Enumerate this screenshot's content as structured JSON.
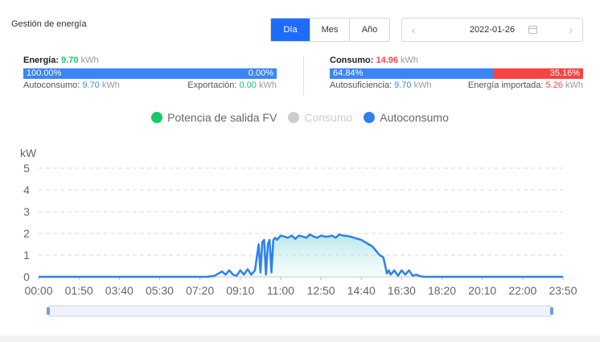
{
  "header": {
    "title": "Gestión de energía"
  },
  "period_tabs": [
    {
      "label": "Día",
      "active": true
    },
    {
      "label": "Mes",
      "active": false
    },
    {
      "label": "Año",
      "active": false
    }
  ],
  "date_picker": {
    "value": "2022-01-26",
    "prev_icon": "chevron-left-icon",
    "next_icon": "chevron-right-icon",
    "calendar_icon": "calendar-icon"
  },
  "energy": {
    "label": "Energía:",
    "value": "9.70",
    "unit": "kWh",
    "bar_left_pct": "100.00%",
    "bar_right_pct": "0.00%",
    "self_consumption_label": "Autoconsumo:",
    "self_consumption_value": "9.70",
    "export_label": "Exportación:",
    "export_value": "0.00"
  },
  "consumption": {
    "label": "Consumo:",
    "value": "14.96",
    "unit": "kWh",
    "bar_left_pct": "64.84%",
    "bar_right_pct": "35.16%",
    "self_sufficiency_label": "Autosuficiencia:",
    "self_sufficiency_value": "9.70",
    "imported_label": "Energía importada:",
    "imported_value": "5.26"
  },
  "legend": [
    {
      "label": "Potencia de salida FV",
      "color": "#17c96b",
      "active": true
    },
    {
      "label": "Consumo",
      "color": "#cccccc",
      "active": false
    },
    {
      "label": "Autoconsumo",
      "color": "#2f80ed",
      "active": true
    }
  ],
  "chart_data": {
    "type": "area",
    "ylabel": "kW",
    "ylim": [
      0,
      5
    ],
    "yticks": [
      "0",
      "1",
      "2",
      "3",
      "4",
      "5"
    ],
    "xticks": [
      "00:00",
      "01:50",
      "03:40",
      "05:30",
      "07:20",
      "09:10",
      "11:00",
      "12:50",
      "14:40",
      "16:30",
      "18:20",
      "20:10",
      "22:00",
      "23:50"
    ],
    "xrange_minutes": [
      0,
      1430
    ],
    "grid": true,
    "series": [
      {
        "name": "Autoconsumo",
        "color": "#2f80ed",
        "x": [
          "00:00",
          "07:40",
          "08:00",
          "08:20",
          "08:30",
          "08:40",
          "08:50",
          "09:00",
          "09:10",
          "09:20",
          "09:30",
          "09:40",
          "09:50",
          "10:00",
          "10:05",
          "10:10",
          "10:15",
          "10:20",
          "10:25",
          "10:30",
          "10:35",
          "10:40",
          "10:45",
          "10:50",
          "11:00",
          "11:10",
          "11:20",
          "11:30",
          "11:40",
          "11:50",
          "12:00",
          "12:10",
          "12:20",
          "12:30",
          "12:40",
          "12:50",
          "13:00",
          "13:10",
          "13:20",
          "13:30",
          "13:40",
          "13:50",
          "14:00",
          "14:10",
          "14:20",
          "14:30",
          "14:40",
          "14:50",
          "15:00",
          "15:10",
          "15:20",
          "15:30",
          "15:40",
          "15:50",
          "15:55",
          "16:00",
          "16:10",
          "16:20",
          "16:30",
          "16:40",
          "16:50",
          "17:00",
          "17:10",
          "17:20",
          "17:30",
          "17:40",
          "18:00",
          "23:50"
        ],
        "values": [
          0,
          0,
          0.05,
          0.25,
          0.1,
          0.3,
          0.1,
          0.05,
          0.3,
          0.1,
          0.35,
          0.1,
          0.3,
          1.5,
          0.2,
          1.6,
          1.7,
          0.1,
          1.5,
          1.7,
          0.2,
          1.7,
          1.8,
          1.7,
          1.9,
          1.85,
          1.8,
          1.9,
          1.75,
          1.9,
          1.85,
          1.8,
          1.95,
          1.85,
          1.8,
          1.9,
          1.85,
          1.85,
          1.9,
          1.8,
          1.95,
          1.9,
          1.88,
          1.85,
          1.8,
          1.75,
          1.7,
          1.6,
          1.5,
          1.4,
          1.2,
          1.0,
          0.9,
          0.15,
          0.3,
          0.1,
          0.3,
          0.05,
          0.3,
          0.1,
          0.3,
          0.05,
          0.1,
          0.03,
          0,
          0,
          0,
          0
        ]
      }
    ]
  }
}
